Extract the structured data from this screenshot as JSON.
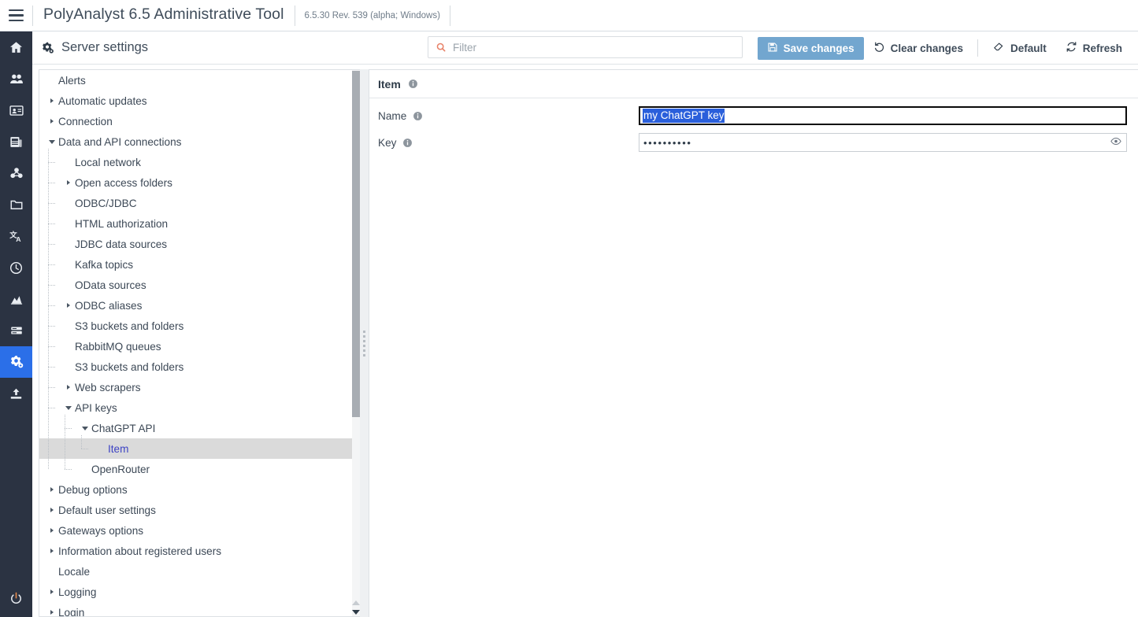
{
  "topbar": {
    "menu_icon": "hamburger-icon",
    "app_title": "PolyAnalyst 6.5 Administrative Tool",
    "version": "6.5.30 Rev. 539 (alpha; Windows)"
  },
  "rail": {
    "items": [
      {
        "icon": "home-icon",
        "name": "home",
        "active": false
      },
      {
        "icon": "users-icon",
        "name": "users",
        "active": false
      },
      {
        "icon": "id-card-icon",
        "name": "id-card",
        "active": false
      },
      {
        "icon": "news-icon",
        "name": "news",
        "active": false
      },
      {
        "icon": "nodes-icon",
        "name": "nodes",
        "active": false
      },
      {
        "icon": "folder-icon",
        "name": "folder",
        "active": false
      },
      {
        "icon": "translate-icon",
        "name": "translate",
        "active": false
      },
      {
        "icon": "clock-icon",
        "name": "scheduler",
        "active": false
      },
      {
        "icon": "chart-icon",
        "name": "statistics",
        "active": false
      },
      {
        "icon": "server-icon",
        "name": "server",
        "active": false
      },
      {
        "icon": "gears-icon",
        "name": "server-settings",
        "active": true
      },
      {
        "icon": "upload-icon",
        "name": "upload",
        "active": false
      }
    ],
    "bottom": {
      "icon": "power-icon",
      "name": "logout"
    }
  },
  "pagehead": {
    "icon": "gears-icon",
    "title": "Server settings"
  },
  "filter": {
    "icon": "search-icon",
    "placeholder": "Filter",
    "value": ""
  },
  "toolbar": {
    "save_label": "Save changes",
    "save_icon": "floppy-disk-icon",
    "clear_label": "Clear changes",
    "clear_icon": "undo-icon",
    "default_label": "Default",
    "default_icon": "eraser-icon",
    "refresh_label": "Refresh",
    "refresh_icon": "sync-icon",
    "accent": "#72a6cf"
  },
  "tree": {
    "items": [
      {
        "label": "Alerts",
        "depth": 0,
        "caret": "none",
        "selected": false
      },
      {
        "label": "Automatic updates",
        "depth": 0,
        "caret": "closed",
        "selected": false
      },
      {
        "label": "Connection",
        "depth": 0,
        "caret": "closed",
        "selected": false
      },
      {
        "label": "Data and API connections",
        "depth": 0,
        "caret": "open",
        "selected": false
      },
      {
        "label": "Local network",
        "depth": 1,
        "caret": "none",
        "selected": false
      },
      {
        "label": "Open access folders",
        "depth": 1,
        "caret": "closed",
        "selected": false
      },
      {
        "label": "ODBC/JDBC",
        "depth": 1,
        "caret": "none",
        "selected": false
      },
      {
        "label": "HTML authorization",
        "depth": 1,
        "caret": "none",
        "selected": false
      },
      {
        "label": "JDBC data sources",
        "depth": 1,
        "caret": "none",
        "selected": false
      },
      {
        "label": "Kafka topics",
        "depth": 1,
        "caret": "none",
        "selected": false
      },
      {
        "label": "OData sources",
        "depth": 1,
        "caret": "none",
        "selected": false
      },
      {
        "label": "ODBC aliases",
        "depth": 1,
        "caret": "closed",
        "selected": false
      },
      {
        "label": "S3 buckets and folders",
        "depth": 1,
        "caret": "none",
        "selected": false
      },
      {
        "label": "RabbitMQ queues",
        "depth": 1,
        "caret": "none",
        "selected": false
      },
      {
        "label": "S3 buckets and folders",
        "depth": 1,
        "caret": "none",
        "selected": false
      },
      {
        "label": "Web scrapers",
        "depth": 1,
        "caret": "closed",
        "selected": false
      },
      {
        "label": "API keys",
        "depth": 1,
        "caret": "open",
        "selected": false
      },
      {
        "label": "ChatGPT API",
        "depth": 2,
        "caret": "open",
        "selected": false
      },
      {
        "label": "Item",
        "depth": 3,
        "caret": "none",
        "selected": true
      },
      {
        "label": "OpenRouter",
        "depth": 2,
        "caret": "none",
        "selected": false
      },
      {
        "label": "Debug options",
        "depth": 0,
        "caret": "closed",
        "selected": false
      },
      {
        "label": "Default user settings",
        "depth": 0,
        "caret": "closed",
        "selected": false
      },
      {
        "label": "Gateways options",
        "depth": 0,
        "caret": "closed",
        "selected": false
      },
      {
        "label": "Information about registered users",
        "depth": 0,
        "caret": "closed",
        "selected": false
      },
      {
        "label": "Locale",
        "depth": 0,
        "caret": "none",
        "selected": false
      },
      {
        "label": "Logging",
        "depth": 0,
        "caret": "closed",
        "selected": false
      },
      {
        "label": "Login",
        "depth": 0,
        "caret": "closed",
        "selected": false
      }
    ]
  },
  "form": {
    "header_title": "Item",
    "header_info_icon": "info-icon",
    "fields": [
      {
        "label": "Name",
        "info_icon": "info-icon",
        "type": "text",
        "value": "my ChatGPT key",
        "selected": true,
        "focused": true
      },
      {
        "label": "Key",
        "info_icon": "info-icon",
        "type": "password",
        "value": "••••••••••",
        "reveal_icon": "eye-icon",
        "selected": false,
        "focused": false
      }
    ]
  }
}
